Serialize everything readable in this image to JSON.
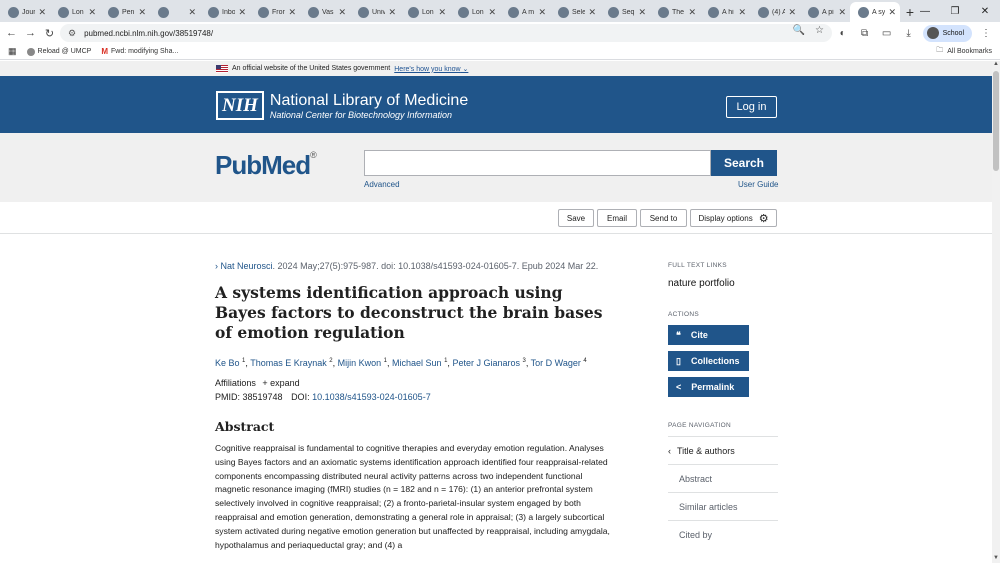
{
  "browser": {
    "tabs": [
      {
        "label": "Jour",
        "active": false
      },
      {
        "label": "Lon",
        "active": false
      },
      {
        "label": "Pen",
        "active": false
      },
      {
        "label": "",
        "active": false
      },
      {
        "label": "Inbo",
        "active": false
      },
      {
        "label": "Fron",
        "active": false
      },
      {
        "label": "Vas",
        "active": false
      },
      {
        "label": "Univ",
        "active": false
      },
      {
        "label": "Lon",
        "active": false
      },
      {
        "label": "Lon",
        "active": false
      },
      {
        "label": "A m",
        "active": false
      },
      {
        "label": "Sele",
        "active": false
      },
      {
        "label": "Seq",
        "active": false
      },
      {
        "label": "The",
        "active": false
      },
      {
        "label": "A hi",
        "active": false
      },
      {
        "label": "(4) A",
        "active": false
      },
      {
        "label": "A pi",
        "active": false
      },
      {
        "label": "A sy",
        "active": true
      }
    ],
    "url": "pubmed.ncbi.nlm.nih.gov/38519748/",
    "profile_label": "School",
    "bookmarks": [
      "Reload @ UMCP",
      "Fwd: modifying Sha..."
    ],
    "all_bookmarks_label": "All Bookmarks"
  },
  "gov_banner": {
    "text": "An official website of the United States government",
    "link": "Here's how you know"
  },
  "header": {
    "nih_logo": "NIH",
    "title": "National Library of Medicine",
    "subtitle": "National Center for Biotechnology Information",
    "login_label": "Log in"
  },
  "search": {
    "logo": "PubMed",
    "button_label": "Search",
    "advanced_label": "Advanced",
    "user_guide_label": "User Guide",
    "value": ""
  },
  "actions_bar": {
    "save": "Save",
    "email": "Email",
    "send_to": "Send to",
    "display_options": "Display options"
  },
  "article": {
    "journal": "Nat Neurosci",
    "citation": ". 2024 May;27(5):975-987. doi: 10.1038/s41593-024-01605-7. Epub 2024 Mar 22.",
    "title": "A systems identification approach using Bayes factors to deconstruct the brain bases of emotion regulation",
    "authors": [
      {
        "name": "Ke Bo",
        "sup": "1"
      },
      {
        "name": "Thomas E Kraynak",
        "sup": "2"
      },
      {
        "name": "Mijin Kwon",
        "sup": "1"
      },
      {
        "name": "Michael Sun",
        "sup": "1"
      },
      {
        "name": "Peter J Gianaros",
        "sup": "3"
      },
      {
        "name": "Tor D Wager",
        "sup": "4"
      }
    ],
    "affiliations_label": "Affiliations",
    "expand_label": "expand",
    "pmid_label": "PMID: 38519748",
    "doi_label": "DOI:",
    "doi": "10.1038/s41593-024-01605-7",
    "abstract_heading": "Abstract",
    "abstract_text": "Cognitive reappraisal is fundamental to cognitive therapies and everyday emotion regulation. Analyses using Bayes factors and an axiomatic systems identification approach identified four reappraisal-related components encompassing distributed neural activity patterns across two independent functional magnetic resonance imaging (fMRI) studies (n = 182 and n = 176): (1) an anterior prefrontal system selectively involved in cognitive reappraisal; (2) a fronto-parietal-insular system engaged by both reappraisal and emotion generation, demonstrating a general role in appraisal; (3) a largely subcortical system activated during negative emotion generation but unaffected by reappraisal, including amygdala, hypothalamus and periaqueductal gray; and (4) a"
  },
  "sidebar": {
    "full_text_heading": "FULL TEXT LINKS",
    "publisher": "nature portfolio",
    "actions_heading": "ACTIONS",
    "cite": "Cite",
    "collections": "Collections",
    "permalink": "Permalink",
    "page_nav_heading": "PAGE NAVIGATION",
    "page_nav": [
      "Title & authors",
      "Abstract",
      "Similar articles",
      "Cited by"
    ]
  }
}
